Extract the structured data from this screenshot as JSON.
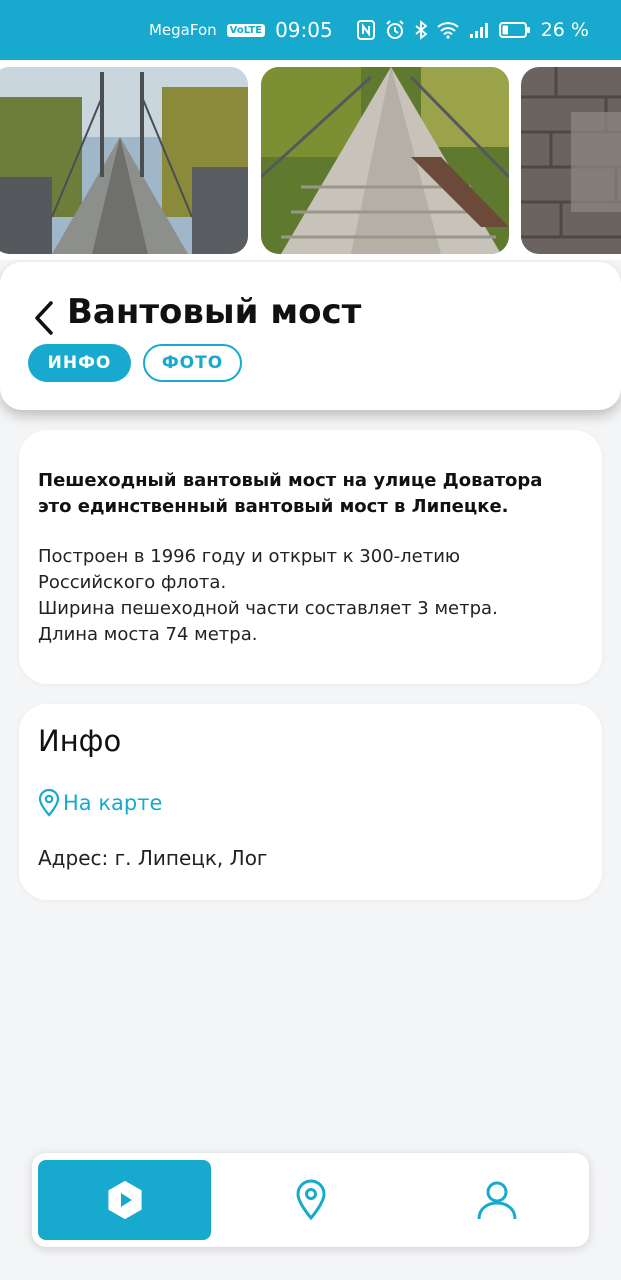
{
  "status_bar": {
    "carrier": "MegaFon",
    "volte": "VoLTE",
    "time": "09:05",
    "battery": "26 %"
  },
  "header": {
    "title": "Вантовый мост",
    "tabs": [
      {
        "label": "ИНФО",
        "active": true
      },
      {
        "label": "ФОТО",
        "active": false
      }
    ]
  },
  "description": {
    "lead_lines": [
      "Пешеходный вантовый мост на улице Доватора",
      "это единственный вантовый мост в Липецке."
    ],
    "body_lines": [
      "Построен в 1996 году и открыт к 300-летию",
      "Российского флота.",
      "Ширина пешеходной части составляет 3 метра.",
      "Длина моста 74 метра."
    ]
  },
  "info": {
    "title": "Инфо",
    "map_link": "На карте",
    "address": "Адрес: г. Липецк, Лог"
  },
  "bottom_nav": {
    "items": [
      "play-icon",
      "location-pin-icon",
      "person-icon"
    ],
    "active_index": 0
  },
  "colors": {
    "accent": "#18aace",
    "text": "#111111",
    "background": "#f4f5f6"
  }
}
